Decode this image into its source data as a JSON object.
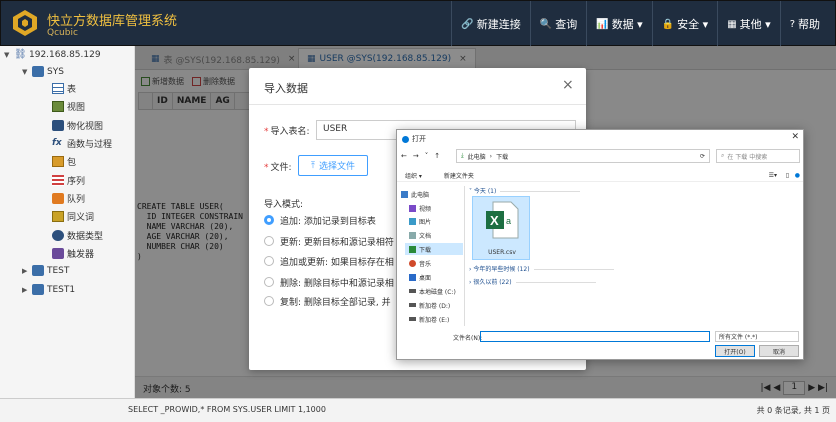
{
  "header": {
    "title": "快立方数据库管理系统",
    "subtitle": "Qcubic",
    "nav": [
      {
        "icon": "🔗",
        "label": "新建连接"
      },
      {
        "icon": "🔍",
        "label": "查询"
      },
      {
        "icon": "📊",
        "label": "数据 ▾"
      },
      {
        "icon": "🔒",
        "label": "安全 ▾"
      },
      {
        "icon": "▦",
        "label": "其他 ▾"
      },
      {
        "icon": "?",
        "label": "帮助"
      }
    ]
  },
  "sidebar": {
    "connection": "192.168.85.129",
    "schema_sys": "SYS",
    "items": [
      "表",
      "视图",
      "物化视图",
      "函数与过程",
      "包",
      "序列",
      "队列",
      "同义词",
      "数据类型",
      "触发器"
    ],
    "schema_test": "TEST",
    "schema_test1": "TEST1"
  },
  "tabs": [
    {
      "label": "表 @SYS(192.168.85.129)"
    },
    {
      "label": "USER @SYS(192.168.85.129)"
    }
  ],
  "toolbar": {
    "new_data": "新增数据",
    "delete_data": "删除数据"
  },
  "grid": {
    "columns": [
      "ID",
      "NAME",
      "AG"
    ]
  },
  "sql_ddl": "CREATE TABLE USER(\n  ID INTEGER CONSTRAIN\n  NAME VARCHAR (20),\n  AGE VARCHAR (20),\n  NUMBER CHAR (20)\n)",
  "status": {
    "object_count": "对象个数: 5",
    "page": "1"
  },
  "bottom": {
    "sql": "SELECT _PROWID,* FROM SYS.USER LIMIT 1,1000",
    "info": "共 0 条记录, 共 1 页"
  },
  "import_dialog": {
    "title": "导入数据",
    "table_label": "导入表名:",
    "table_value": "USER",
    "file_label": "文件:",
    "upload_label": "选择文件",
    "mode_label": "导入模式:",
    "modes": [
      "追加: 添加记录到目标表",
      "更新: 更新目标和源记录相符",
      "追加或更新: 如果目标存在相",
      "删除: 删除目标中和源记录相",
      "复制: 删除目标全部记录, 并"
    ]
  },
  "file_dialog": {
    "title": "打开",
    "path": [
      "此电脑",
      "下载"
    ],
    "search_placeholder": "在 下载 中搜索",
    "organize": "组织 ▾",
    "new_folder": "新建文件夹",
    "nav_items": [
      "此电脑",
      "视频",
      "图片",
      "文档",
      "下载",
      "音乐",
      "桌面",
      "本地磁盘 (C:)",
      "新加卷 (D:)",
      "新加卷 (E:)"
    ],
    "sections": [
      "今天 (1)",
      "今年的早些时候 (12)",
      "很久以前 (22)"
    ],
    "file_name": "USER.csv",
    "filename_label": "文件名(N):",
    "filetype": "所有文件 (*.*)",
    "open_button": "打开(O)",
    "cancel_button": "取消",
    "colors": {
      "excel": "#1d6f42",
      "accent": "#0078d7"
    }
  }
}
